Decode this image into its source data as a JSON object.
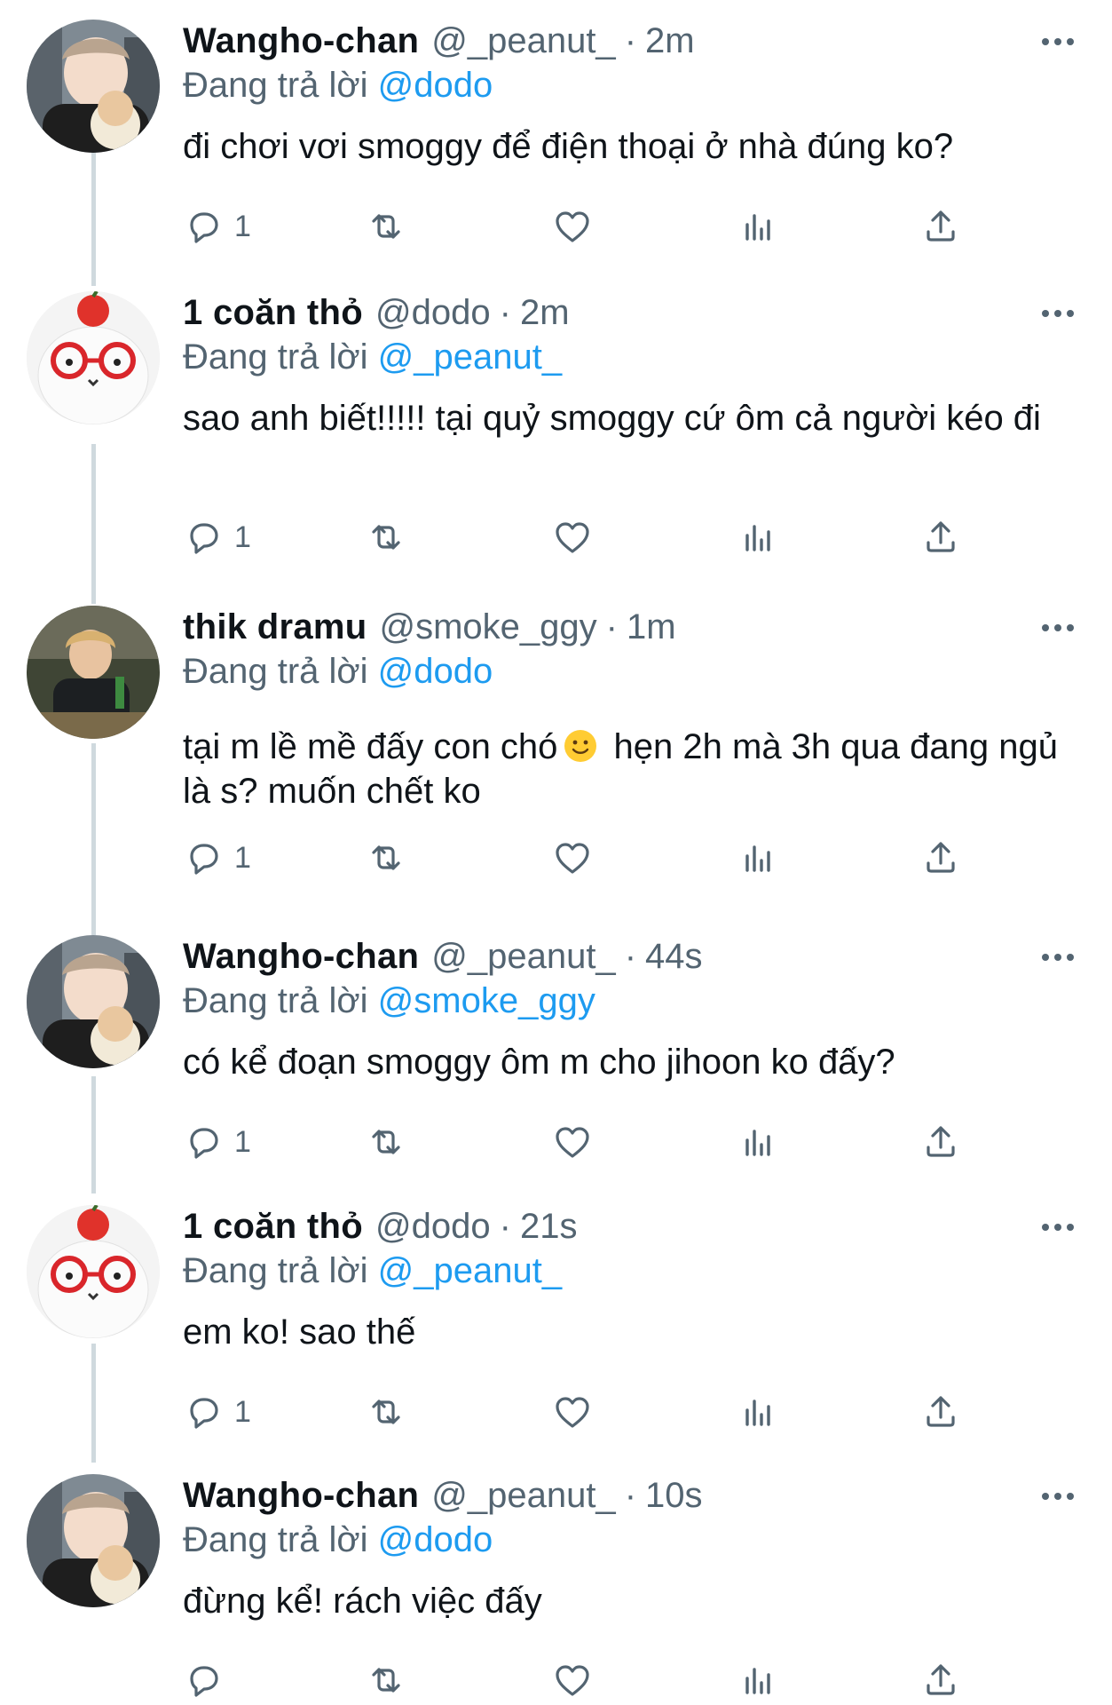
{
  "replying_label": "Đang trả lời",
  "tweets": [
    {
      "name": "Wangho-chan",
      "handle": "@_peanut_",
      "time": "2m",
      "reply_to": "@dodo",
      "text": "đi chơi vơi smoggy để điện thoại ở nhà đúng ko?",
      "reply_count": "1",
      "avatar": "wangho-avatar"
    },
    {
      "name": "1 coăn thỏ",
      "handle": "@dodo",
      "time": "2m",
      "reply_to": "@_peanut_",
      "text": "sao anh biết!!!!! tại quỷ smoggy cứ ôm cả người kéo đi",
      "reply_count": "1",
      "avatar": "bunny-avatar"
    },
    {
      "name": "thik dramu",
      "handle": "@smoke_ggy",
      "time": "1m",
      "reply_to": "@dodo",
      "text_a": "tại m lề mề đấy con chó",
      "text_b": "hẹn 2h mà 3h qua đang ngủ là s? muốn chết ko",
      "reply_count": "1",
      "avatar": "smoke-avatar",
      "emoji": "slightly-smiling-face-emoji"
    },
    {
      "name": "Wangho-chan",
      "handle": "@_peanut_",
      "time": "44s",
      "reply_to": "@smoke_ggy",
      "text": "có kể đoạn smoggy ôm m cho jihoon ko đấy?",
      "reply_count": "1",
      "avatar": "wangho-avatar"
    },
    {
      "name": "1 coăn thỏ",
      "handle": "@dodo",
      "time": "21s",
      "reply_to": "@_peanut_",
      "text": "em ko! sao thế",
      "reply_count": "1",
      "avatar": "bunny-avatar"
    },
    {
      "name": "Wangho-chan",
      "handle": "@_peanut_",
      "time": "10s",
      "reply_to": "@dodo",
      "text": "đừng kể! rách việc đấy",
      "reply_count": "",
      "avatar": "wangho-avatar"
    }
  ]
}
